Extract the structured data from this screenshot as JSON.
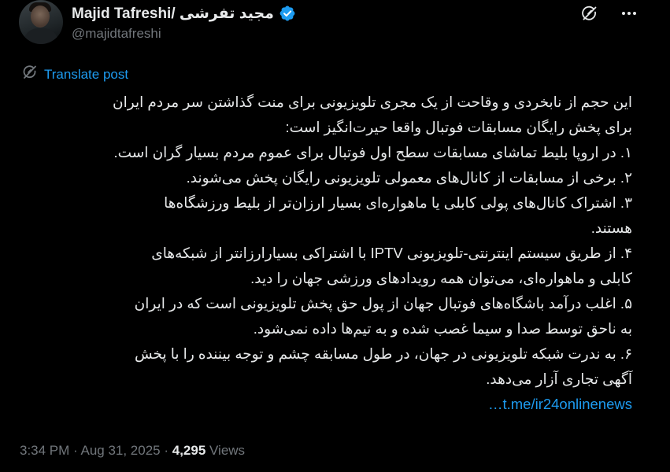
{
  "author": {
    "display_name": "Majid Tafreshi/ مجید تفرشی",
    "handle": "@majidtafreshi",
    "verified_color": "#1d9bf0"
  },
  "header_icons": [
    "grok-icon",
    "more-icon"
  ],
  "translate_label": "Translate post",
  "tweet": {
    "lines": [
      "این حجم از نابخردی و وقاحت از یک مجری تلویزیونی برای منت گذاشتن سر مردم ایران",
      "برای پخش رایگان مسابقات فوتبال واقعا حیرت‌انگیز است:",
      "۱. در اروپا بلیط تماشای مسابقات سطح اول فوتبال برای عموم مردم بسیار گران است.",
      "۲. برخی از مسابقات از کانال‌های معمولی تلویزیونی رایگان پخش می‌شوند.",
      "۳. اشتراک کانال‌های پولی کابلی یا ماهواره‌ای بسیار ارزان‌تر از بلیط ورزشگاه‌ها",
      "هستند.",
      "۴. از طریق سیستم اینترنتی-تلویزیونی IPTV با اشتراکی بسیارارزانتر از شبکه‌های",
      "کابلی و ماهواره‌ای، می‌توان همه رویدادهای ورزشی جهان را دید.",
      "۵. اغلب درآمد باشگاه‌های فوتبال جهان از پول حق پخش تلویزیونی است که در ایران",
      "به ناحق توسط صدا و سیما غصب شده و به تیم‌ها داده نمی‌شود.",
      "۶. به ندرت شبکه تلویزیونی در جهان، در طول مسابقه چشم و توجه بیننده را با پخش",
      "آگهی تجاری آزار می‌دهد."
    ],
    "link": "t.me/ir24onlinenews…"
  },
  "meta": {
    "time": "3:34 PM",
    "separator": " · ",
    "date": "Aug 31, 2025",
    "views_count": "4,295",
    "views_label": " Views"
  }
}
